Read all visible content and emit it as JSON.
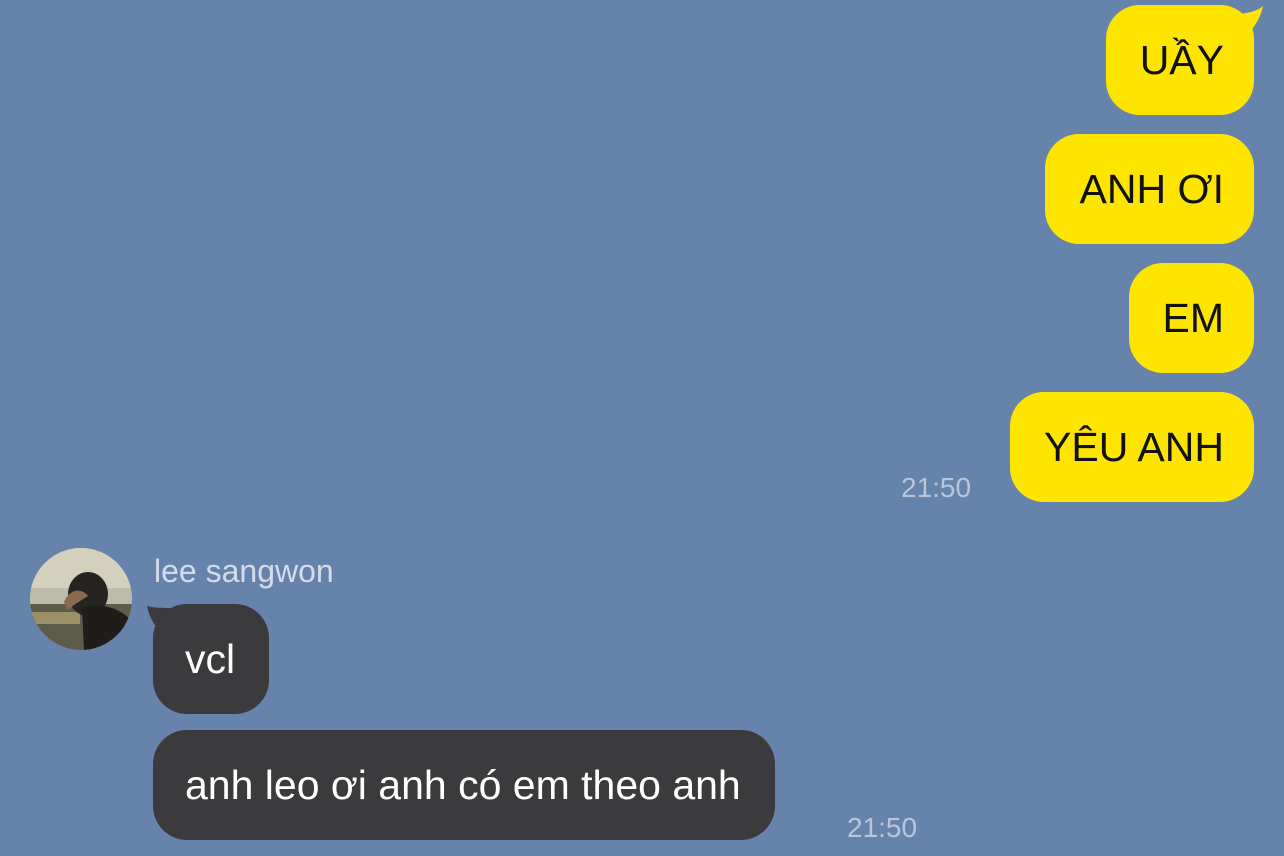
{
  "theme": {
    "background": "#6683ab",
    "outgoing_bubble": "#fee500",
    "incoming_bubble": "#3b3b3d",
    "timestamp_color": "#b9c6d9"
  },
  "outgoing": {
    "messages": [
      "UẦY",
      "ANH ƠI",
      "EM",
      "YÊU ANH"
    ],
    "time": "21:50"
  },
  "incoming": {
    "sender_name": "lee sangwon",
    "avatar_icon": "profile-photo-avatar",
    "messages": [
      "vcl",
      "anh leo ơi anh có em theo anh"
    ],
    "time": "21:50"
  }
}
